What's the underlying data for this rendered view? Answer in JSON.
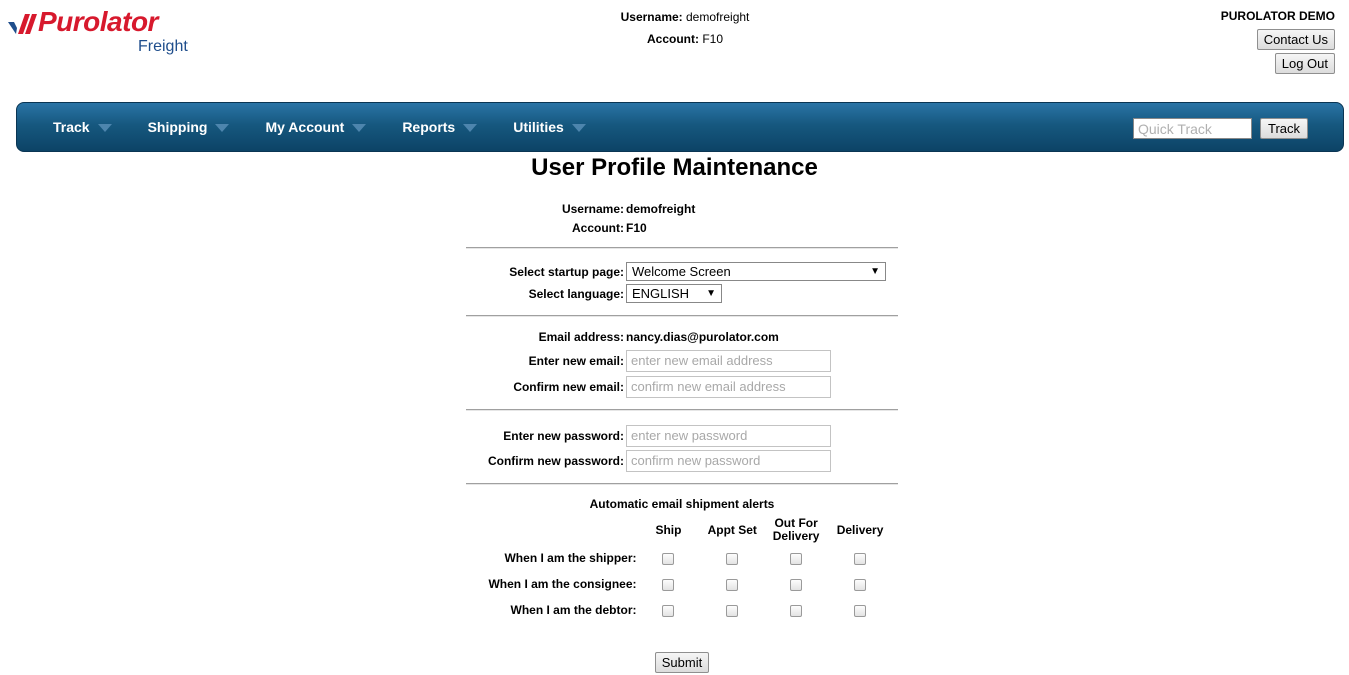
{
  "logo": {
    "word": "Purolator",
    "sub": "Freight"
  },
  "header": {
    "username_label": "Username:",
    "username": "demofreight",
    "account_label": "Account:",
    "account": "F10",
    "company": "PUROLATOR DEMO",
    "contact_label": "Contact Us",
    "logout_label": "Log Out"
  },
  "nav": {
    "items": [
      "Track",
      "Shipping",
      "My Account",
      "Reports",
      "Utilities"
    ],
    "quick_track_placeholder": "Quick Track",
    "track_button": "Track"
  },
  "page": {
    "title": "User Profile Maintenance",
    "username_label": "Username:",
    "username": "demofreight",
    "account_label": "Account:",
    "account": "F10",
    "startup_label": "Select startup page:",
    "startup_value": "Welcome Screen",
    "language_label": "Select language:",
    "language_value": "ENGLISH",
    "email_label": "Email address:",
    "email_value": "nancy.dias@purolator.com",
    "new_email_label": "Enter new email:",
    "new_email_placeholder": "enter new email address",
    "confirm_email_label": "Confirm new email:",
    "confirm_email_placeholder": "confirm new email address",
    "new_password_label": "Enter new password:",
    "new_password_placeholder": "enter new password",
    "confirm_password_label": "Confirm new password:",
    "confirm_password_placeholder": "confirm new password",
    "alerts_title": "Automatic email shipment alerts",
    "alert_columns": [
      "Ship",
      "Appt Set",
      "Out For Delivery",
      "Delivery"
    ],
    "alert_rows": [
      "When I am the shipper:",
      "When I am the consignee:",
      "When I am the debtor:"
    ],
    "submit_label": "Submit"
  }
}
